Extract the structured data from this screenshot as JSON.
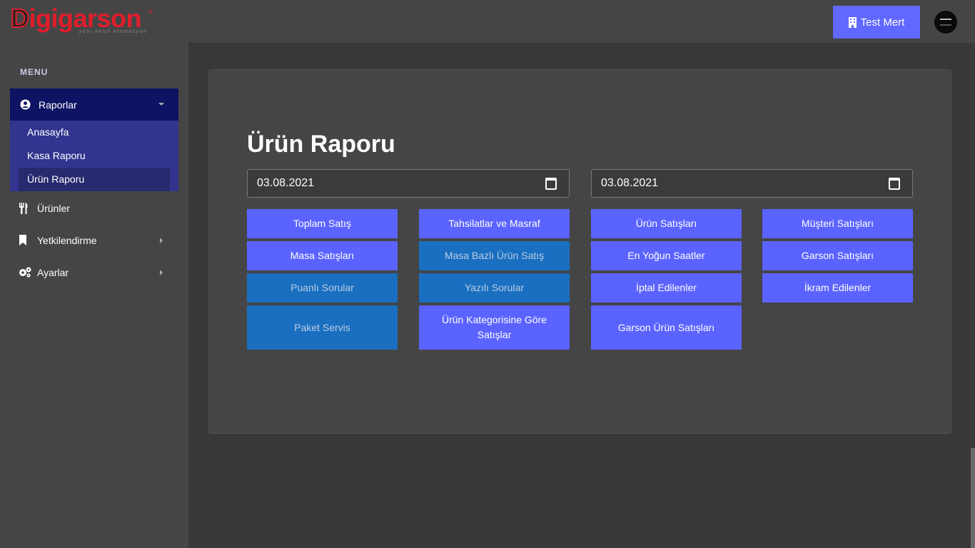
{
  "brand": {
    "logo_prefix": "D",
    "logo_mid": "igi",
    "logo_suffix": "garson",
    "registered": "®",
    "tagline": "yeni nesil otomasyon",
    "accent": "#e11d2b"
  },
  "header": {
    "user_label": "Test Mert",
    "user_icon": "building-icon",
    "avatar_icon": "avatar"
  },
  "sidebar": {
    "menu_title": "MENU",
    "reports": {
      "label": "Raporlar",
      "icon": "user-circle-icon",
      "items": [
        {
          "label": "Anasayfa"
        },
        {
          "label": "Kasa Raporu"
        },
        {
          "label": "Ürün Raporu",
          "active": true
        }
      ]
    },
    "items": [
      {
        "label": "Ürünler",
        "icon": "utensils-icon"
      },
      {
        "label": "Yetkilendirme",
        "icon": "bookmark-icon"
      },
      {
        "label": "Ayarlar",
        "icon": "gears-icon"
      }
    ]
  },
  "main": {
    "title": "Ürün Raporu",
    "date_start": "03.08.2021",
    "date_end": "03.08.2021",
    "buttons": [
      {
        "label": "Toplam Satış",
        "style": "primary"
      },
      {
        "label": "Tahsilatlar ve Masraf",
        "style": "primary"
      },
      {
        "label": "Ürün Satışları",
        "style": "primary"
      },
      {
        "label": "Müşteri Satışları",
        "style": "primary"
      },
      {
        "label": "Masa Satışları",
        "style": "primary"
      },
      {
        "label": "Masa Bazlı Ürün Satış",
        "style": "secondary"
      },
      {
        "label": "En Yoğun Saatler",
        "style": "primary"
      },
      {
        "label": "Garson Satışları",
        "style": "primary"
      },
      {
        "label": "Puanlı Sorular",
        "style": "secondary"
      },
      {
        "label": "Yazılı Sorular",
        "style": "secondary"
      },
      {
        "label": "İptal Edilenler",
        "style": "primary"
      },
      {
        "label": "İkram Edilenler",
        "style": "primary"
      },
      {
        "label": "Paket Servis",
        "style": "secondary"
      },
      {
        "label": "Ürün Kategorisine Göre Satışlar",
        "style": "primary"
      },
      {
        "label": "Garson Ürün Satışları",
        "style": "primary"
      }
    ]
  },
  "colors": {
    "primary_button": "#5b63ff",
    "secondary_button": "#1a6fc0",
    "sidebar_active_header": "#0e1363",
    "submenu_bg": "#32348f"
  }
}
